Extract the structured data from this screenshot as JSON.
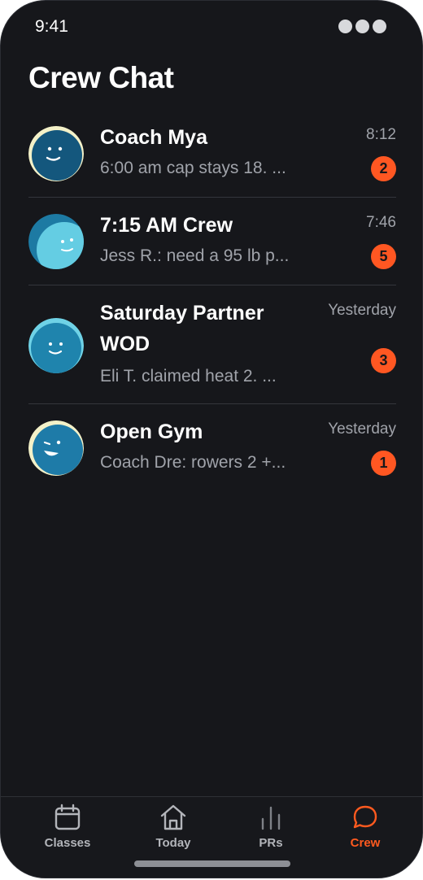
{
  "status_bar": {
    "time": "9:41"
  },
  "header": {
    "title": "Crew Chat"
  },
  "chats": [
    {
      "name": "Coach Mya",
      "preview": "6:00 am cap stays 18. ...",
      "time": "8:12",
      "unread": "2",
      "avatar_icon": "smiling-face-icon"
    },
    {
      "name": "7:15 AM Crew",
      "preview": "Jess R.: need a 95 lb p...",
      "time": "7:46",
      "unread": "5",
      "avatar_icon": "group-face-icon"
    },
    {
      "name": "Saturday Partner WOD",
      "preview": "Eli T. claimed heat 2. ...",
      "time": "Yesterday",
      "unread": "3",
      "avatar_icon": "happy-face-icon"
    },
    {
      "name": "Open Gym",
      "preview": "Coach Dre: rowers 2 +...",
      "time": "Yesterday",
      "unread": "1",
      "avatar_icon": "winking-face-icon"
    }
  ],
  "tabbar": {
    "items": [
      {
        "label": "Classes",
        "icon": "calendar-icon"
      },
      {
        "label": "Today",
        "icon": "home-icon"
      },
      {
        "label": "PRs",
        "icon": "bar-chart-icon"
      },
      {
        "label": "Crew",
        "icon": "chat-bubble-icon",
        "active": true
      }
    ]
  },
  "colors": {
    "background": "#16171b",
    "accent": "#ff5722",
    "text": "#ffffff",
    "muted": "#a0a3aa"
  }
}
